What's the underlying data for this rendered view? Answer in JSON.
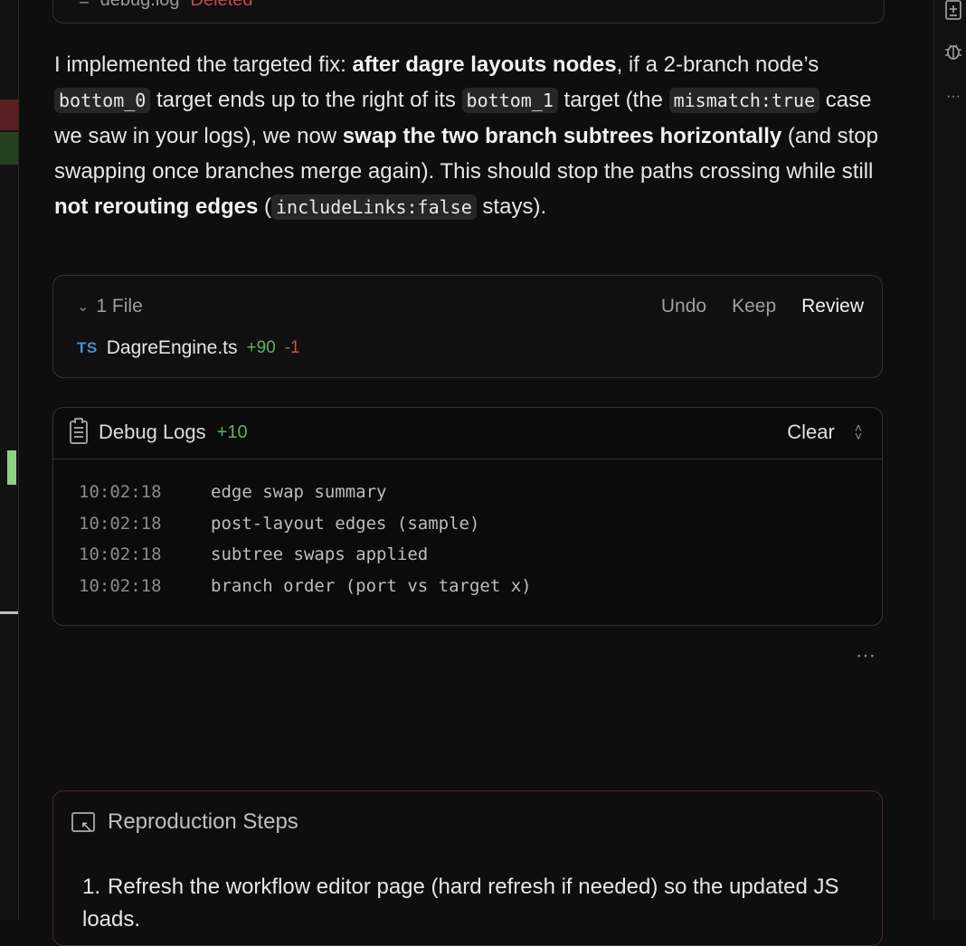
{
  "prev_file": {
    "name": "debug.log",
    "status": "Deleted"
  },
  "message": {
    "seg1": "I implemented the targeted fix: ",
    "b1": "after dagre layouts nodes",
    "seg2": ", if a 2-branch node’s ",
    "c1": "bottom_0",
    "seg3": " target ends up to the right of its ",
    "c2": "bottom_1",
    "seg4": " target (the ",
    "c3": "mismatch:true",
    "seg5": " case we saw in your logs), we now ",
    "b2": "swap the two branch subtrees horizontally",
    "seg6": " (and stop swapping once branches merge again). This should stop the paths crossing while still ",
    "b3": "not rerouting edges",
    "seg7": " (",
    "c4": "includeLinks:false",
    "seg8": " stays)."
  },
  "files_panel": {
    "count_label": "1 File",
    "undo": "Undo",
    "keep": "Keep",
    "review": "Review",
    "file": {
      "type": "TS",
      "name": "DagreEngine.ts",
      "added": "+90",
      "removed": "-1"
    }
  },
  "debug_panel": {
    "title": "Debug Logs",
    "count": "+10",
    "clear": "Clear",
    "logs": [
      {
        "time": "10:02:18",
        "msg": "edge swap summary"
      },
      {
        "time": "10:02:18",
        "msg": "post-layout edges (sample)"
      },
      {
        "time": "10:02:18",
        "msg": "subtree swaps applied"
      },
      {
        "time": "10:02:18",
        "msg": "branch order (port vs target x)"
      }
    ]
  },
  "more": "⋯",
  "repro": {
    "title": "Reproduction Steps",
    "steps": [
      {
        "num": "1.",
        "text": "Refresh the workflow editor page (hard refresh if needed) so the updated JS loads."
      }
    ]
  },
  "colors": {
    "added": "#5fb06a",
    "removed": "#c8533e",
    "ts": "#4a8fd0"
  }
}
